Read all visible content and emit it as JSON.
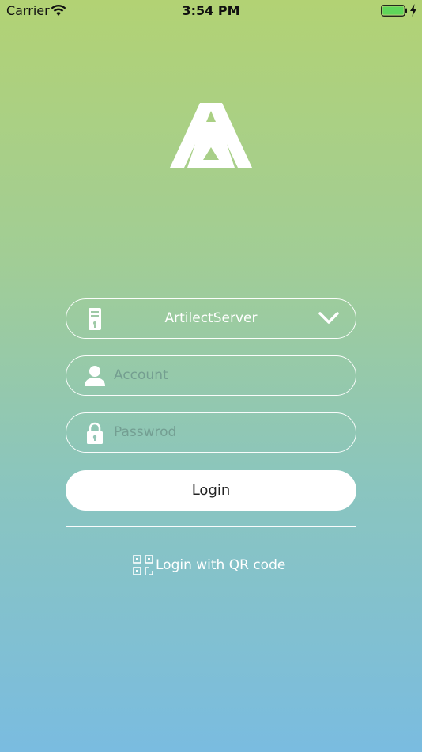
{
  "status_bar": {
    "carrier": "Carrier",
    "time": "3:54 PM"
  },
  "form": {
    "server_name": "ArtilectServer",
    "account_placeholder": "Account",
    "password_placeholder": "Passwrod",
    "login_label": "Login",
    "qr_login_label": "Login with QR code"
  },
  "colors": {
    "gradient_top": "#b2d274",
    "gradient_bottom": "#7abce0",
    "battery_fill": "#5fd65a"
  },
  "icons": {
    "server": "server-icon",
    "account": "user-icon",
    "password": "lock-icon",
    "dropdown": "chevron-down-icon",
    "qr": "qr-code-icon"
  }
}
